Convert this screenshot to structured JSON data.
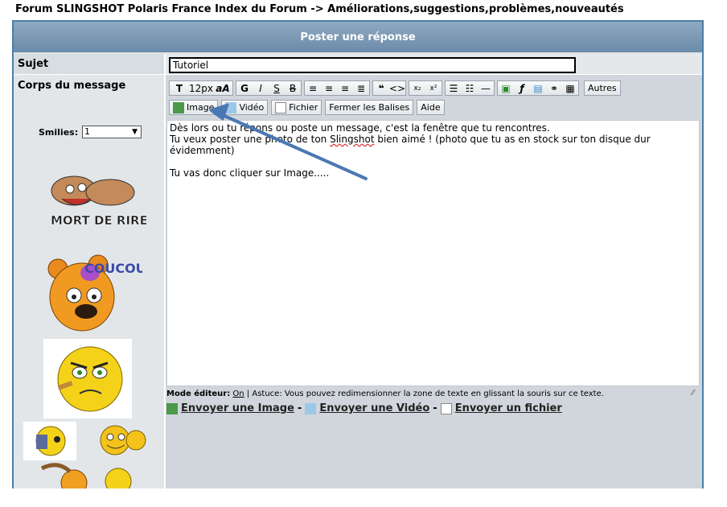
{
  "breadcrumb": "Forum SLINGSHOT Polaris France Index du Forum -> Améliorations,suggestions,problèmes,nouveautés",
  "header": {
    "title": "Poster une réponse"
  },
  "subject": {
    "label": "Sujet",
    "value": "Tutoriel"
  },
  "body": {
    "label": "Corps du message"
  },
  "smilies": {
    "label": "Smilies:",
    "selected": "1"
  },
  "toolbar": {
    "font_size": "12px",
    "others_label": "Autres",
    "row2": [
      "Image",
      "Vidéo",
      "Fichier",
      "Fermer les Balises",
      "Aide"
    ]
  },
  "editor": {
    "line1": "Dès lors ou tu répons ou poste un message, c'est la fenêtre que tu rencontres.",
    "line2a": "Tu veux poster une photo de ton ",
    "line2word": "Slingshot",
    "line2b": " bien aimé ! (photo que tu as en stock sur ton disque dur",
    "line3": "évidemment)",
    "line5": "Tu vas donc cliquer sur Image....."
  },
  "hint": {
    "prefix": "Mode éditeur:",
    "mode": "On",
    "text": "| Astuce: Vous pouvez redimensionner la zone de texte en glissant la souris sur ce texte."
  },
  "send": {
    "image": "Envoyer une Image",
    "video": "Envoyer une Vidéo",
    "file": "Envoyer un fichier",
    "sep": "-"
  },
  "emoticons": {
    "mort_de_rire": "MORT DE RIRE",
    "coucou": "COUCOU"
  },
  "colors": {
    "header_top": "#90a9c0",
    "header_bottom": "#6b8bab",
    "frame": "#4a7fa8",
    "arrow": "#4a78b4"
  }
}
